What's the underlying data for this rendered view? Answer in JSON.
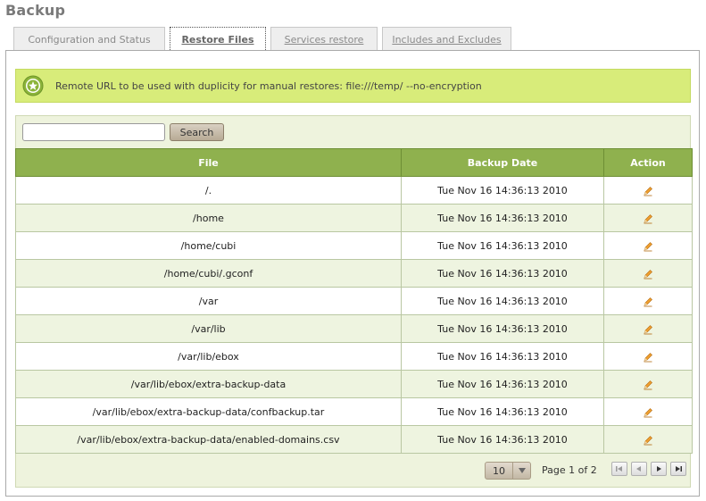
{
  "page": {
    "title": "Backup"
  },
  "tabs": [
    {
      "label": "Configuration and Status",
      "active": false
    },
    {
      "label": "Restore Files",
      "active": true
    },
    {
      "label": "Services restore",
      "active": false
    },
    {
      "label": "Includes and Excludes",
      "active": false
    }
  ],
  "note": {
    "icon": "star-badge-icon",
    "text": "Remote URL to be used with duplicity for manual restores: file:///temp/ --no-encryption"
  },
  "search": {
    "value": "",
    "placeholder": "",
    "button_label": "Search"
  },
  "table": {
    "columns": [
      "File",
      "Backup Date",
      "Action"
    ],
    "rows": [
      {
        "file": "/.",
        "date": "Tue Nov 16 14:36:13 2010",
        "action_icon": "edit-pencil-icon"
      },
      {
        "file": "/home",
        "date": "Tue Nov 16 14:36:13 2010",
        "action_icon": "edit-pencil-icon"
      },
      {
        "file": "/home/cubi",
        "date": "Tue Nov 16 14:36:13 2010",
        "action_icon": "edit-pencil-icon"
      },
      {
        "file": "/home/cubi/.gconf",
        "date": "Tue Nov 16 14:36:13 2010",
        "action_icon": "edit-pencil-icon"
      },
      {
        "file": "/var",
        "date": "Tue Nov 16 14:36:13 2010",
        "action_icon": "edit-pencil-icon"
      },
      {
        "file": "/var/lib",
        "date": "Tue Nov 16 14:36:13 2010",
        "action_icon": "edit-pencil-icon"
      },
      {
        "file": "/var/lib/ebox",
        "date": "Tue Nov 16 14:36:13 2010",
        "action_icon": "edit-pencil-icon"
      },
      {
        "file": "/var/lib/ebox/extra-backup-data",
        "date": "Tue Nov 16 14:36:13 2010",
        "action_icon": "edit-pencil-icon"
      },
      {
        "file": "/var/lib/ebox/extra-backup-data/confbackup.tar",
        "date": "Tue Nov 16 14:36:13 2010",
        "action_icon": "edit-pencil-icon"
      },
      {
        "file": "/var/lib/ebox/extra-backup-data/enabled-domains.csv",
        "date": "Tue Nov 16 14:36:13 2010",
        "action_icon": "edit-pencil-icon"
      }
    ]
  },
  "pager": {
    "page_size": "10",
    "page_label": "Page 1 of 2",
    "buttons": [
      "first-page-icon",
      "previous-page-icon",
      "next-page-icon",
      "last-page-icon"
    ]
  },
  "colors": {
    "header_green": "#8fb14e",
    "note_background": "#d8ec7a",
    "row_alt": "#eef4e0"
  }
}
